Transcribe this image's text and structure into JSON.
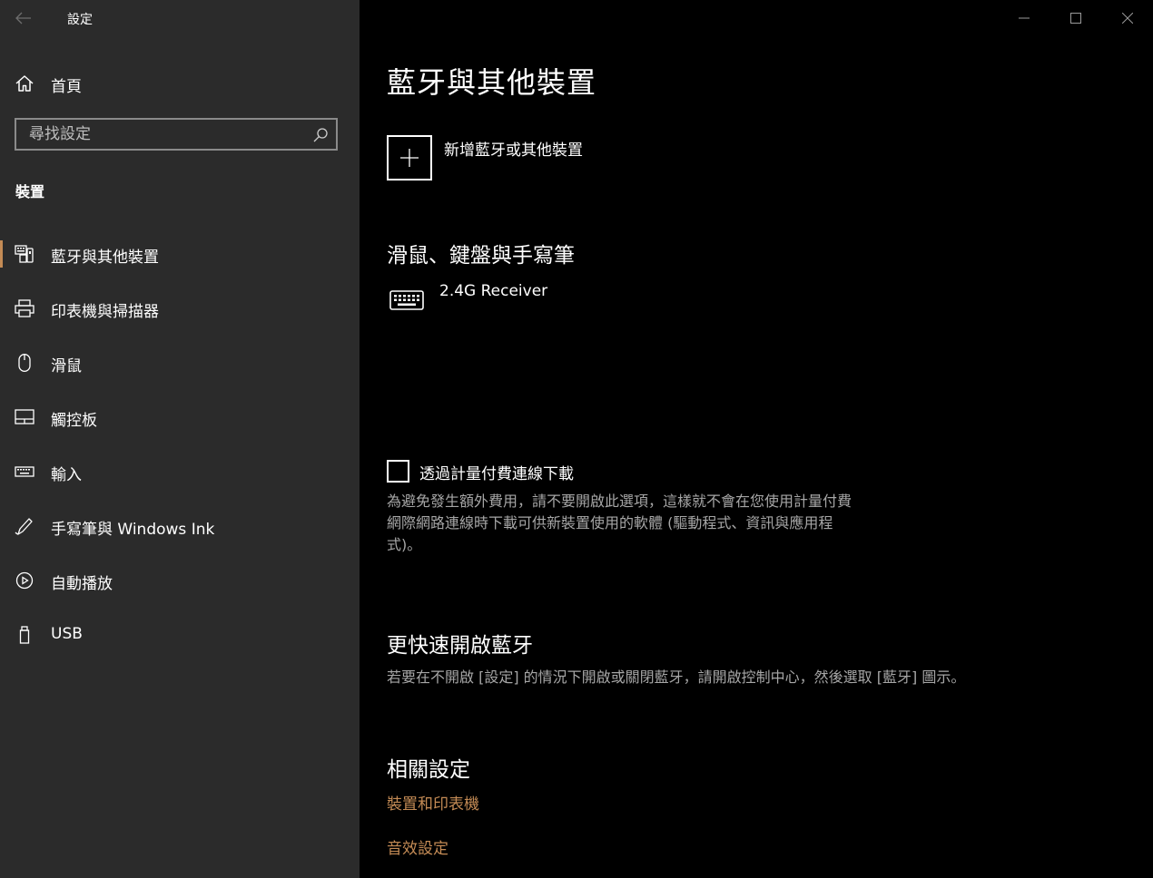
{
  "window": {
    "title": "設定"
  },
  "sidebar": {
    "home_label": "首頁",
    "search_placeholder": "尋找設定",
    "section_label": "裝置",
    "items": [
      {
        "label": "藍牙與其他裝置",
        "icon": "bluetooth-devices-icon",
        "active": true
      },
      {
        "label": "印表機與掃描器",
        "icon": "printer-icon"
      },
      {
        "label": "滑鼠",
        "icon": "mouse-icon"
      },
      {
        "label": "觸控板",
        "icon": "touchpad-icon"
      },
      {
        "label": "輸入",
        "icon": "keyboard-icon"
      },
      {
        "label": "手寫筆與 Windows Ink",
        "icon": "pen-icon"
      },
      {
        "label": "自動播放",
        "icon": "autoplay-icon"
      },
      {
        "label": "USB",
        "icon": "usb-icon"
      }
    ]
  },
  "main": {
    "page_title": "藍牙與其他裝置",
    "add_device_label": "新增藍牙或其他裝置",
    "mouse_section_title": "滑鼠、鍵盤與手寫筆",
    "devices": [
      {
        "name": "2.4G Receiver",
        "icon": "keyboard-icon"
      }
    ],
    "metered": {
      "label": "透過計量付費連線下載",
      "checked": false,
      "description_lines": [
        "為避免發生額外費用，請不要開啟此選項，這樣就不會在您使用計量付費",
        "網際網路連線時下載可供新裝置使用的軟體 (驅動程式、資訊與應用程",
        "式)。"
      ]
    },
    "quick_bt": {
      "title": "更快速開啟藍牙",
      "description": "若要在不開啟 [設定] 的情況下開啟或關閉藍牙，請開啟控制中心，然後選取 [藍牙] 圖示。"
    },
    "related": {
      "title": "相關設定",
      "links": [
        "裝置和印表機",
        "音效設定"
      ]
    }
  },
  "colors": {
    "accent": "#c48b55",
    "sidebar_bg": "#2b2b2b",
    "main_bg": "#000000",
    "secondary_text": "#a6a6a6"
  }
}
